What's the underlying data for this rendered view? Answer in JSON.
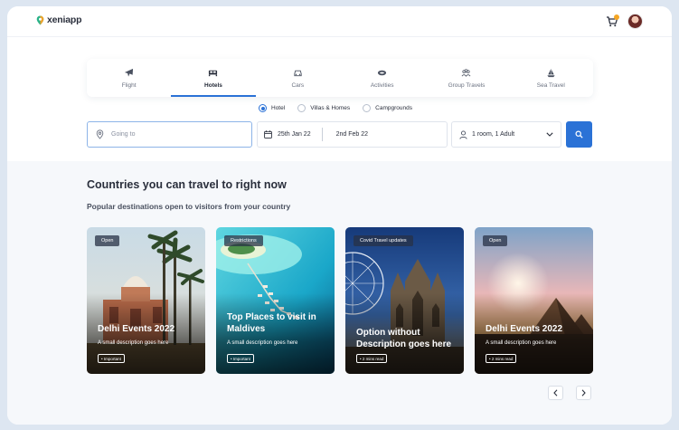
{
  "app": {
    "name": "xeniapp"
  },
  "colors": {
    "accent": "#2b72d6",
    "cart_badge": "#f5a623"
  },
  "header": {
    "cart_icon": "cart-icon",
    "avatar": "user-avatar"
  },
  "tabs": [
    {
      "label": "Flight",
      "icon": "airplane-icon",
      "active": false
    },
    {
      "label": "Hotels",
      "icon": "bed-icon",
      "active": true
    },
    {
      "label": "Cars",
      "icon": "car-icon",
      "active": false
    },
    {
      "label": "Activities",
      "icon": "ticket-icon",
      "active": false
    },
    {
      "label": "Group Travels",
      "icon": "group-icon",
      "active": false
    },
    {
      "label": "Sea Travel",
      "icon": "sailboat-icon",
      "active": false
    }
  ],
  "stay_types": [
    {
      "label": "Hotel",
      "checked": true
    },
    {
      "label": "Villas & Homes",
      "checked": false
    },
    {
      "label": "Campgrounds",
      "checked": false
    }
  ],
  "search": {
    "destination_placeholder": "Going to",
    "check_in": "25th Jan 22",
    "check_out": "2nd Feb 22",
    "guests": "1 room, 1 Adult"
  },
  "section": {
    "title": "Countries you can travel to right now",
    "subtitle": "Popular destinations open to visitors from your country"
  },
  "cards": [
    {
      "badge": "Open",
      "title": "Delhi Events 2022",
      "description": "A small description goes here",
      "chip": "• Important"
    },
    {
      "badge": "Restrictions",
      "title": "Top Places to visit in Maldives",
      "description": "A small description goes here",
      "chip": "• Important"
    },
    {
      "badge": "Covid Travel updates",
      "title": "Option without Description goes here",
      "description": "",
      "chip": "• 2 mins read"
    },
    {
      "badge": "Open",
      "title": "Delhi Events 2022",
      "description": "A small description goes here",
      "chip": "• 2 mins read"
    }
  ]
}
